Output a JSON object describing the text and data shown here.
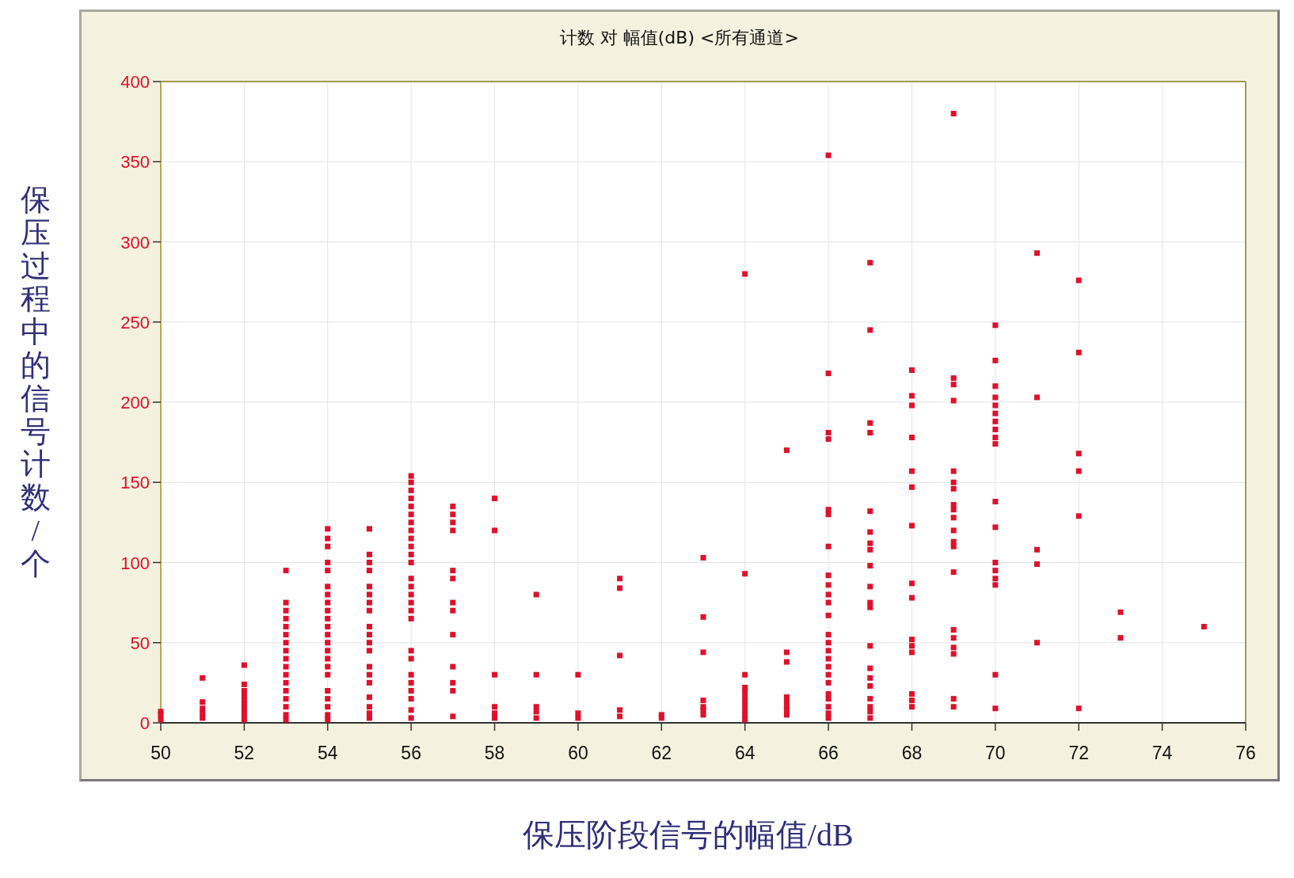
{
  "y_axis_label": "保压过程中的信号计数/个",
  "chart_panel": {
    "title": "计数 对 幅值(dB) <所有通道>",
    "chart_data": {
      "type": "scatter",
      "xlim": [
        50,
        76
      ],
      "ylim": [
        0,
        400
      ],
      "xticks": [
        50,
        52,
        54,
        56,
        58,
        60,
        62,
        64,
        66,
        68,
        70,
        72,
        74,
        76
      ],
      "yticks": [
        0,
        50,
        100,
        150,
        200,
        250,
        300,
        350,
        400
      ],
      "grid": true,
      "x": [
        50,
        50,
        50,
        51,
        51,
        51,
        51,
        51,
        52,
        52,
        52,
        52,
        52,
        52,
        52,
        52,
        52,
        53,
        53,
        53,
        53,
        53,
        53,
        53,
        53,
        53,
        53,
        53,
        53,
        53,
        53,
        53,
        53,
        53,
        54,
        54,
        54,
        54,
        54,
        54,
        54,
        54,
        54,
        54,
        54,
        54,
        54,
        54,
        54,
        54,
        54,
        54,
        54,
        54,
        54,
        54,
        55,
        55,
        55,
        55,
        55,
        55,
        55,
        55,
        55,
        55,
        55,
        55,
        55,
        55,
        55,
        55,
        55,
        55,
        55,
        56,
        56,
        56,
        56,
        56,
        56,
        56,
        56,
        56,
        56,
        56,
        56,
        56,
        56,
        56,
        56,
        56,
        56,
        56,
        56,
        56,
        56,
        56,
        56,
        56,
        56,
        57,
        57,
        57,
        57,
        57,
        57,
        57,
        57,
        57,
        57,
        57,
        57,
        57,
        58,
        58,
        58,
        58,
        58,
        58,
        59,
        59,
        59,
        59,
        59,
        60,
        60,
        60,
        61,
        61,
        61,
        61,
        61,
        62,
        62,
        63,
        63,
        63,
        63,
        63,
        63,
        63,
        64,
        64,
        64,
        64,
        64,
        64,
        64,
        64,
        64,
        64,
        64,
        65,
        65,
        65,
        65,
        65,
        65,
        65,
        65,
        66,
        66,
        66,
        66,
        66,
        66,
        66,
        66,
        66,
        66,
        66,
        66,
        66,
        66,
        66,
        66,
        66,
        66,
        66,
        66,
        66,
        66,
        66,
        66,
        67,
        67,
        67,
        67,
        67,
        67,
        67,
        67,
        67,
        67,
        67,
        67,
        67,
        67,
        67,
        67,
        67,
        67,
        67,
        67,
        68,
        68,
        68,
        68,
        68,
        68,
        68,
        68,
        68,
        68,
        68,
        68,
        68,
        68,
        68,
        69,
        69,
        69,
        69,
        69,
        69,
        69,
        69,
        69,
        69,
        69,
        69,
        69,
        69,
        69,
        69,
        69,
        69,
        69,
        69,
        70,
        70,
        70,
        70,
        70,
        70,
        70,
        70,
        70,
        70,
        70,
        70,
        70,
        70,
        70,
        70,
        70,
        70,
        71,
        71,
        71,
        71,
        71,
        72,
        72,
        72,
        72,
        72,
        72,
        73,
        73,
        75
      ],
      "series": [
        {
          "color": "#e0102a",
          "values": [
            2,
            5,
            7,
            3,
            6,
            9,
            13,
            28,
            2,
            5,
            8,
            11,
            14,
            17,
            20,
            24,
            36,
            2,
            5,
            10,
            15,
            20,
            25,
            30,
            35,
            40,
            45,
            50,
            55,
            60,
            65,
            70,
            75,
            95,
            2,
            5,
            10,
            15,
            20,
            30,
            35,
            40,
            45,
            50,
            55,
            60,
            65,
            70,
            75,
            80,
            85,
            95,
            100,
            110,
            115,
            121,
            3,
            6,
            10,
            16,
            25,
            30,
            35,
            45,
            50,
            55,
            60,
            70,
            75,
            80,
            85,
            95,
            100,
            105,
            121,
            3,
            8,
            15,
            20,
            25,
            30,
            40,
            45,
            65,
            70,
            75,
            80,
            85,
            90,
            100,
            105,
            110,
            115,
            120,
            125,
            130,
            135,
            140,
            145,
            150,
            154,
            4,
            20,
            25,
            35,
            55,
            70,
            75,
            90,
            95,
            120,
            125,
            130,
            135,
            3,
            6,
            10,
            30,
            120,
            140,
            3,
            7,
            10,
            30,
            80,
            3,
            6,
            30,
            4,
            8,
            42,
            84,
            90,
            3,
            5,
            5,
            8,
            10,
            14,
            44,
            66,
            103,
            2,
            5,
            8,
            11,
            14,
            17,
            20,
            22,
            30,
            93,
            280,
            5,
            8,
            10,
            13,
            16,
            38,
            44,
            170,
            3,
            6,
            10,
            15,
            18,
            25,
            30,
            35,
            40,
            45,
            50,
            55,
            67,
            75,
            80,
            86,
            92,
            110,
            130,
            133,
            177,
            181,
            218,
            354,
            3,
            7,
            10,
            15,
            23,
            28,
            34,
            48,
            72,
            75,
            85,
            98,
            108,
            112,
            119,
            132,
            181,
            187,
            245,
            287,
            10,
            14,
            18,
            44,
            48,
            52,
            78,
            87,
            123,
            147,
            157,
            178,
            198,
            204,
            220,
            10,
            15,
            43,
            47,
            53,
            58,
            94,
            110,
            113,
            120,
            128,
            133,
            136,
            146,
            150,
            157,
            201,
            211,
            215,
            380,
            9,
            30,
            86,
            90,
            95,
            100,
            122,
            138,
            174,
            178,
            183,
            188,
            193,
            198,
            203,
            210,
            226,
            248,
            50,
            99,
            108,
            203,
            293,
            9,
            129,
            157,
            168,
            231,
            276,
            53,
            69,
            60
          ]
        }
      ]
    }
  },
  "x_axis_label": "保压阶段信号的幅值/dB"
}
